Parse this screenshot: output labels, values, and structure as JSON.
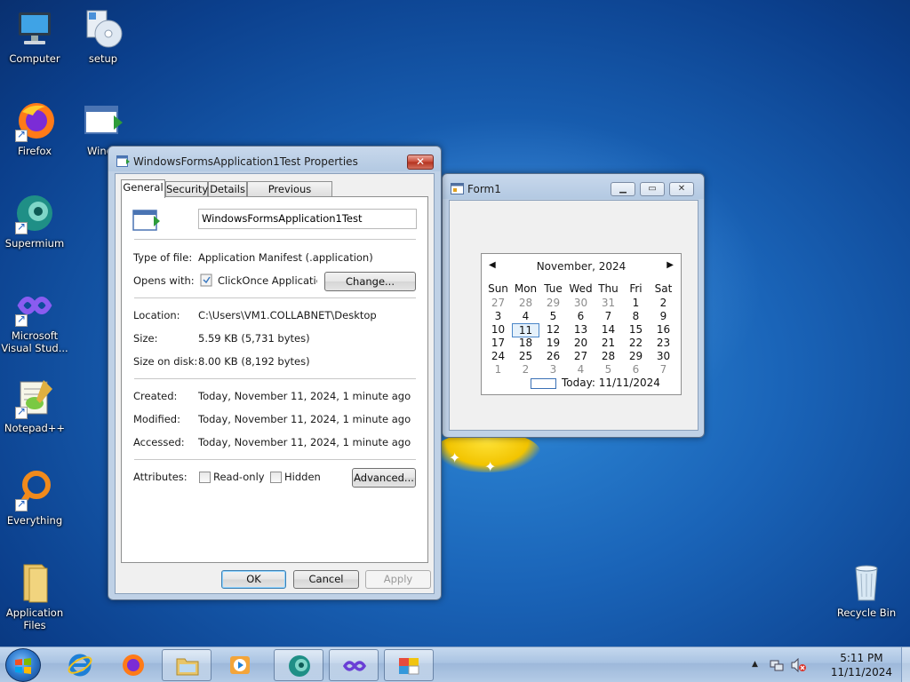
{
  "desktop": {
    "icons": [
      {
        "label": "Computer"
      },
      {
        "label": "setup"
      },
      {
        "label": "Firefox"
      },
      {
        "label": "Windo"
      },
      {
        "label": "Supermium"
      },
      {
        "label": "Microsoft Visual Stud..."
      },
      {
        "label": "Notepad++"
      },
      {
        "label": "Everything"
      },
      {
        "label": "Application Files"
      },
      {
        "label": "Recycle Bin"
      }
    ]
  },
  "props_dialog": {
    "title": "WindowsFormsApplication1Test Properties",
    "close_glyph": "✕",
    "tabs": [
      "General",
      "Security",
      "Details",
      "Previous Versions"
    ],
    "file_name": "WindowsFormsApplication1Test",
    "type_label": "Type of file:",
    "type_value": "Application Manifest (.application)",
    "opens_label": "Opens with:",
    "opens_value": "ClickOnce Application D",
    "change_button": "Change...",
    "location_label": "Location:",
    "location_value": "C:\\Users\\VM1.COLLABNET\\Desktop",
    "size_label": "Size:",
    "size_value": "5.59 KB (5,731 bytes)",
    "size_on_disk_label": "Size on disk:",
    "size_on_disk_value": "8.00 KB (8,192 bytes)",
    "created_label": "Created:",
    "created_value": "Today, November 11, 2024, 1 minute ago",
    "modified_label": "Modified:",
    "modified_value": "Today, November 11, 2024, 1 minute ago",
    "accessed_label": "Accessed:",
    "accessed_value": "Today, November 11, 2024, 1 minute ago",
    "attributes_label": "Attributes:",
    "readonly_label": "Read-only",
    "readonly_checked": false,
    "hidden_label": "Hidden",
    "hidden_checked": false,
    "advanced_button": "Advanced...",
    "ok_button": "OK",
    "cancel_button": "Cancel",
    "apply_button": "Apply"
  },
  "form1": {
    "title": "Form1",
    "min_glyph": "▁",
    "max_glyph": "▭",
    "close_glyph": "✕",
    "calendar": {
      "month_label": "November, 2024",
      "prev_glyph": "◀",
      "next_glyph": "▶",
      "days_of_week": [
        "Sun",
        "Mon",
        "Tue",
        "Wed",
        "Thu",
        "Fri",
        "Sat"
      ],
      "weeks": [
        [
          "27",
          "28",
          "29",
          "30",
          "31",
          "1",
          "2"
        ],
        [
          "3",
          "4",
          "5",
          "6",
          "7",
          "8",
          "9"
        ],
        [
          "10",
          "11",
          "12",
          "13",
          "14",
          "15",
          "16"
        ],
        [
          "17",
          "18",
          "19",
          "20",
          "21",
          "22",
          "23"
        ],
        [
          "24",
          "25",
          "26",
          "27",
          "28",
          "29",
          "30"
        ],
        [
          "1",
          "2",
          "3",
          "4",
          "5",
          "6",
          "7"
        ]
      ],
      "selected_day": "11",
      "today_label": "Today: 11/11/2024"
    }
  },
  "taskbar": {
    "pinned": [
      "start-orb",
      "internet-explorer",
      "firefox",
      "file-explorer",
      "media-player",
      "supermium",
      "visual-studio",
      "windows-forms-app"
    ],
    "tray_expand_glyph": "▲",
    "time": "5:11 PM",
    "date": "11/11/2024"
  }
}
